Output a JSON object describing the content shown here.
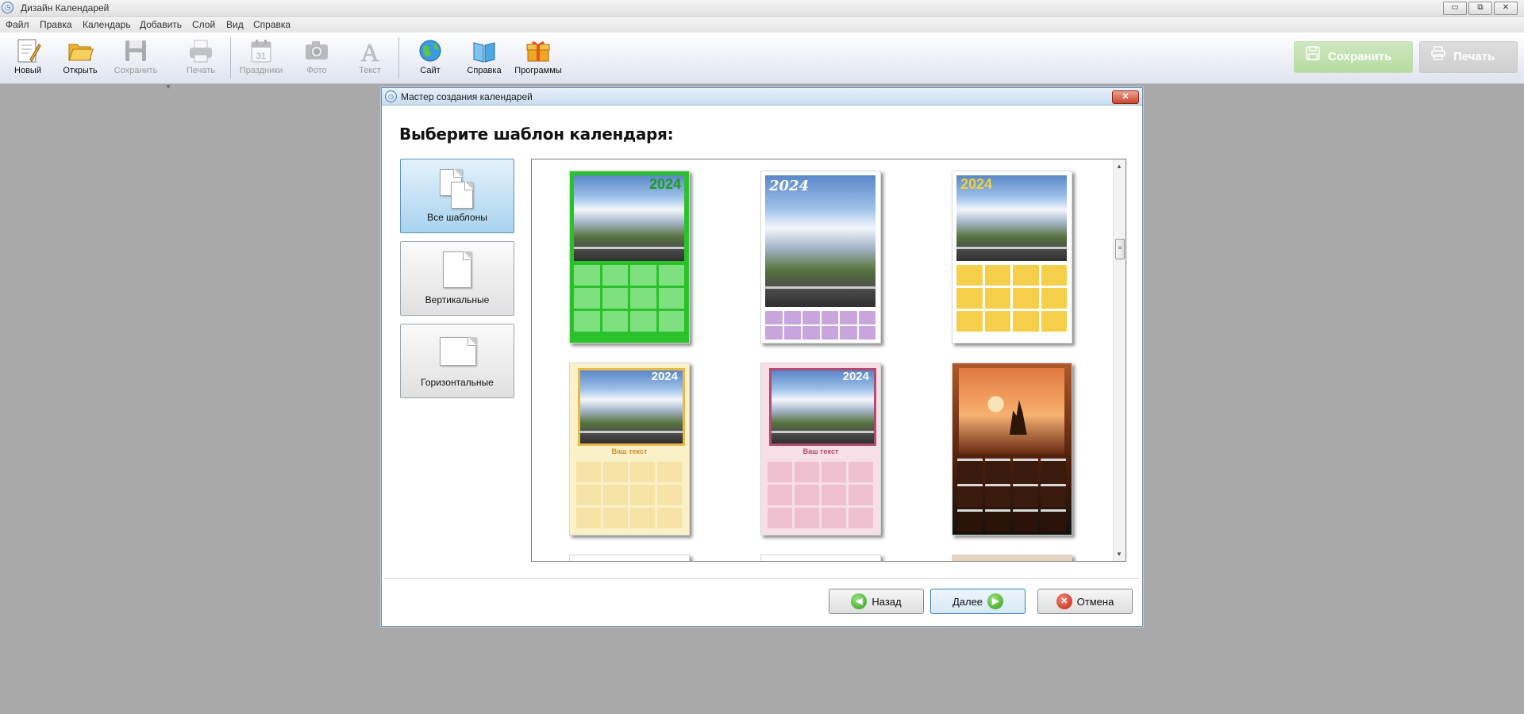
{
  "window": {
    "title": "Дизайн Календарей",
    "controls": [
      "▭",
      "⧉",
      "✕"
    ]
  },
  "menu": [
    "Файл",
    "Правка",
    "Календарь",
    "Добавить",
    "Слой",
    "Вид",
    "Справка"
  ],
  "toolbar": {
    "new": "Новый",
    "open": "Открыть",
    "save": "Сохранить",
    "print": "Печать",
    "holidays": "Праздники",
    "holidays_icon_text": "31",
    "photo": "Фото",
    "text": "Текст",
    "text_icon_glyph": "A",
    "site": "Сайт",
    "help": "Справка",
    "programs": "Программы",
    "save_big": "Сохранить",
    "print_big": "Печать"
  },
  "dialog": {
    "title": "Мастер создания календарей",
    "heading": "Выберите шаблон календаря:",
    "categories": [
      {
        "label": "Все шаблоны",
        "active": true
      },
      {
        "label": "Вертикальные",
        "active": false
      },
      {
        "label": "Горизонтальные",
        "active": false
      }
    ],
    "templates": [
      {
        "year": "2024",
        "year_color": "#1f9a1f",
        "accent": "#34c234"
      },
      {
        "year": "2024",
        "year_color": "#ffffff",
        "accent": "#8a4bb5"
      },
      {
        "year": "2024",
        "year_color": "#f2d23a",
        "accent": "#f0b520"
      },
      {
        "year": "2024",
        "year_color": "#ffffff",
        "accent": "#e7b94a",
        "caption": "Ваш текст"
      },
      {
        "year": "2024",
        "year_color": "#ffffff",
        "accent": "#b24a72",
        "caption": "Ваш текст"
      },
      {
        "year": "",
        "year_color": "#ffffff",
        "accent": "#d9d9d9"
      }
    ],
    "buttons": {
      "back": "Назад",
      "next": "Далее",
      "cancel": "Отмена"
    }
  },
  "colors": {
    "desktop_bg": "#a9a9a9",
    "active_category": "#a9d3ef",
    "save_big_bg": "#b5dca0",
    "print_big_bg": "#cfcfcf"
  }
}
